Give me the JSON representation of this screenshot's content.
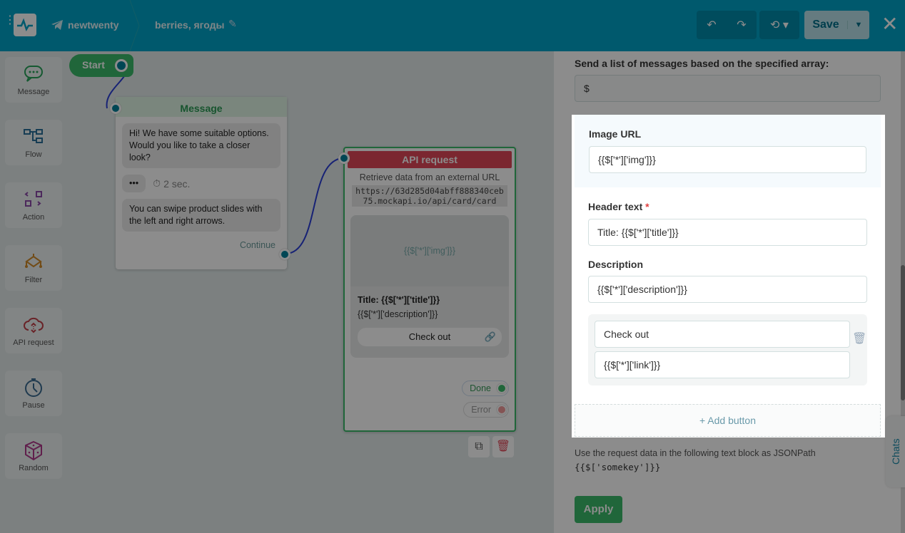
{
  "header": {
    "project": "newtwenty",
    "flow_name": "berries, ягоды",
    "save_label": "Save"
  },
  "tools": [
    {
      "label": "Message",
      "icon": "message-icon",
      "color": "#27a35a"
    },
    {
      "label": "Flow",
      "icon": "flow-icon",
      "color": "#2a6f9a"
    },
    {
      "label": "Action",
      "icon": "action-icon",
      "color": "#8a4aa8"
    },
    {
      "label": "Filter",
      "icon": "filter-icon",
      "color": "#d08a2a"
    },
    {
      "label": "API request",
      "icon": "cloud-icon",
      "color": "#c0404a"
    },
    {
      "label": "Pause",
      "icon": "timer-icon",
      "color": "#3a6a90"
    },
    {
      "label": "Random",
      "icon": "dice-icon",
      "color": "#b03a8a"
    }
  ],
  "start": {
    "label": "Start"
  },
  "message_node": {
    "title": "Message",
    "bubble1": "Hi! We have some suitable options. Would you like to take a closer look?",
    "delay": "2 sec.",
    "bubble2": "You can swipe product slides with the left and right arrows.",
    "continue": "Continue"
  },
  "api_node": {
    "title": "API request",
    "subtitle": "Retrieve data from an external URL",
    "url": "https://63d285d04abff888340ceb75.mockapi.io/api/card/card",
    "img": "{{$['*']['img']}}",
    "card_title": "Title: {{$['*']['title']}}",
    "card_desc": "{{$['*']['description']}}",
    "button": "Check out",
    "done": "Done",
    "error": "Error"
  },
  "panel": {
    "array_label": "Send a list of messages based on the specified array:",
    "array_value": "$",
    "image_label": "Image URL",
    "image_value": "{{$['*']['img']}}",
    "header_label": "Header text",
    "required": "*",
    "header_value": "Title: {{$['*']['title']}}",
    "desc_label": "Description",
    "desc_value": "{{$['*']['description']}}",
    "btn_text": "Check out",
    "btn_link": "{{$['*']['link']}}",
    "add_button": "+ Add button",
    "hint": "Use the request data in the following text block as JSONPath",
    "hint_code": "{{$['somekey']}}",
    "apply": "Apply",
    "chats": "Chats"
  }
}
